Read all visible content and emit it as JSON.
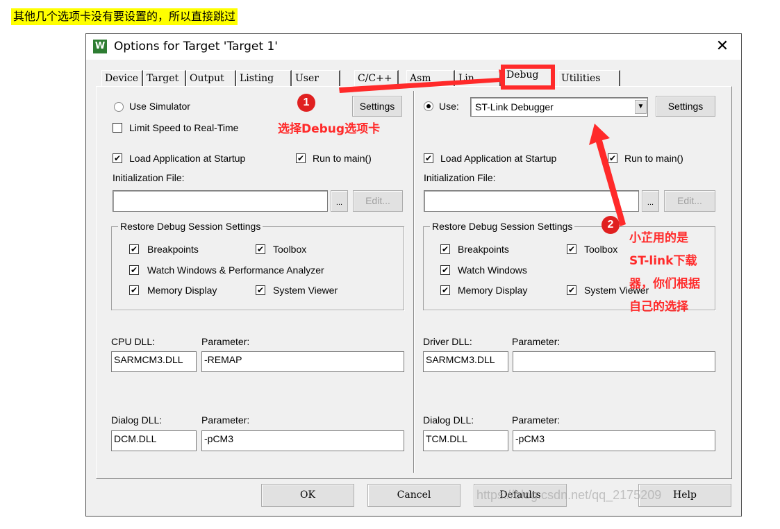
{
  "top_note": "其他几个选项卡没有要设置的，所以直接跳过",
  "window": {
    "icon": "W",
    "title": "Options for Target 'Target 1'",
    "close_glyph": "✕"
  },
  "tabs": [
    "Device",
    "Target",
    "Output",
    "Listing",
    "User",
    "C/C++",
    "Asm",
    "Lin",
    "Debug",
    "Utilities"
  ],
  "left": {
    "use_simulator": "Use Simulator",
    "settings": "Settings",
    "limit_speed": "Limit Speed to Real-Time",
    "load_app": "Load Application at Startup",
    "run_to_main": "Run to main()",
    "init_file": "Initialization File:",
    "browse": "...",
    "edit": "Edit...",
    "restore_title": "Restore Debug Session Settings",
    "breakpoints": "Breakpoints",
    "toolbox": "Toolbox",
    "watch": "Watch Windows & Performance Analyzer",
    "memory": "Memory Display",
    "system_viewer": "System Viewer",
    "cpu_dll_label": "CPU DLL:",
    "param_label": "Parameter:",
    "cpu_dll": "SARMCM3.DLL",
    "cpu_param": "-REMAP",
    "dialog_dll_label": "Dialog DLL:",
    "dialog_dll": "DCM.DLL",
    "dialog_param": "-pCM3"
  },
  "right": {
    "use": "Use:",
    "debugger": "ST-Link Debugger",
    "settings": "Settings",
    "load_app": "Load Application at Startup",
    "run_to_main": "Run to main()",
    "init_file": "Initialization File:",
    "browse": "...",
    "edit": "Edit...",
    "restore_title": "Restore Debug Session Settings",
    "breakpoints": "Breakpoints",
    "toolbox": "Toolbox",
    "watch": "Watch Windows",
    "memory": "Memory Display",
    "system_viewer": "System Viewer",
    "driver_dll_label": "Driver DLL:",
    "param_label": "Parameter:",
    "driver_dll": "SARMCM3.DLL",
    "driver_param": "",
    "dialog_dll_label": "Dialog DLL:",
    "dialog_dll": "TCM.DLL",
    "dialog_param": "-pCM3"
  },
  "annotations": {
    "badge1": "1",
    "badge2": "2",
    "note1": "选择Debug选项卡",
    "note2_line1": "小芷用的是",
    "note2_line2": "ST-link下载",
    "note2_line3": "器，你们根据",
    "note2_line4": "自己的选择",
    "color": "#ff2a2a"
  },
  "buttons": {
    "ok": "OK",
    "cancel": "Cancel",
    "defaults": "Defaults",
    "help": "Help"
  },
  "watermark": "https://blog.csdn.net/qq_2175209"
}
